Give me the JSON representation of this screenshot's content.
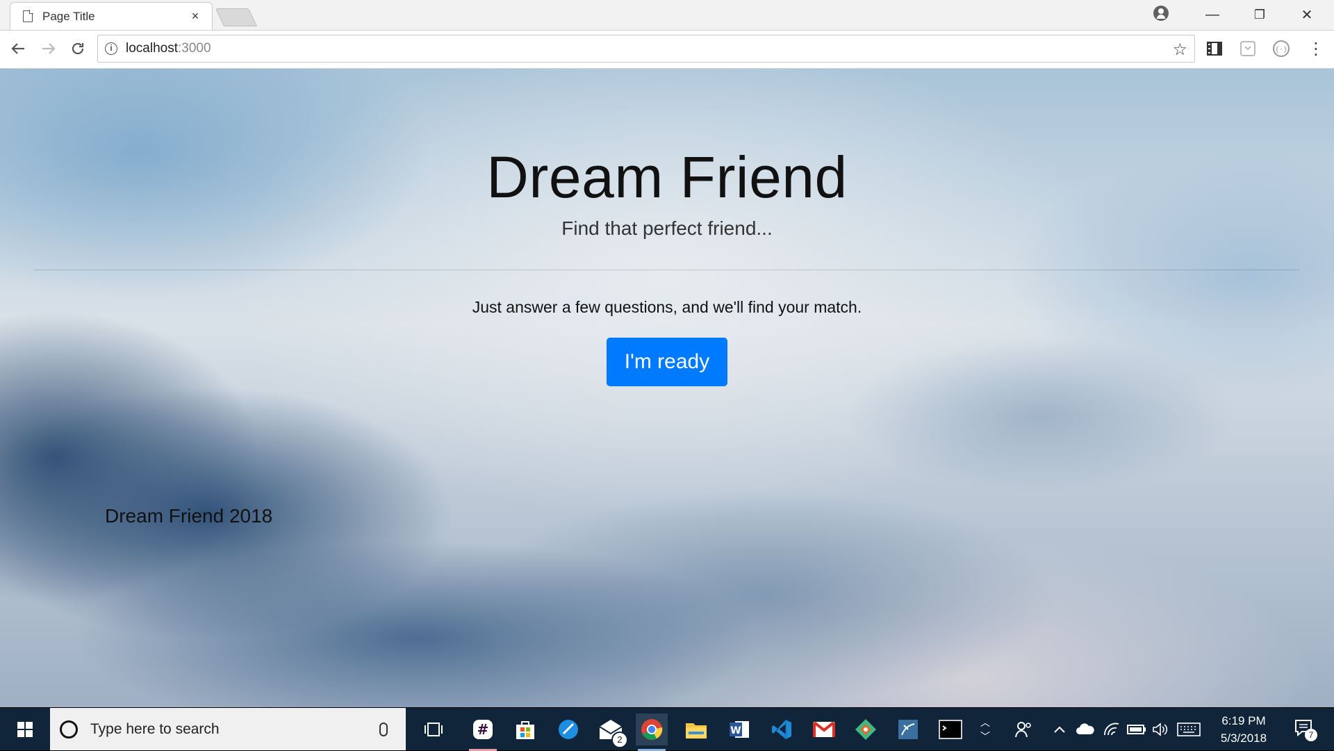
{
  "browser": {
    "tab_title": "Page Title",
    "tab_close": "×",
    "url_host": "localhost",
    "url_port": ":3000",
    "window_controls": {
      "minimize": "—",
      "restore": "❐",
      "close": "✕"
    }
  },
  "page": {
    "title": "Dream Friend",
    "subtitle": "Find that perfect friend...",
    "lead": "Just answer a few questions, and we'll find your match.",
    "cta_label": "I'm ready",
    "footer": "Dream Friend 2018",
    "colors": {
      "cta": "#007bff"
    }
  },
  "taskbar": {
    "search_placeholder": "Type here to search",
    "mail_badge": "2",
    "clock_time": "6:19 PM",
    "clock_date": "5/3/2018",
    "notification_count": "7",
    "apps": [
      "task-view-icon",
      "slack-icon",
      "store-icon",
      "sourcetree-icon",
      "mail-icon",
      "chrome-icon",
      "file-explorer-icon",
      "word-icon",
      "vscode-icon",
      "gmail-icon",
      "git-icon",
      "mysql-workbench-icon",
      "terminal-icon"
    ]
  }
}
